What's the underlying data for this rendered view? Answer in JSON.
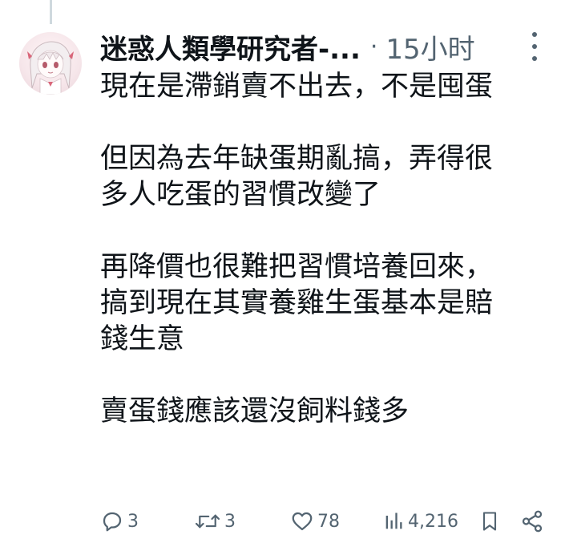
{
  "post": {
    "author": {
      "display_name": "迷惑人類學研究者-...",
      "avatar": "anime-girl-avatar"
    },
    "separator": "·",
    "timestamp": "15小时",
    "more_icon": "more-dots-icon",
    "paragraphs": [
      [
        "現在是滯銷賣不出去，不是囤蛋"
      ],
      [
        "但因為去年缺蛋期亂搞，弄得很",
        "多人吃蛋的習慣改變了"
      ],
      [
        "再降價也很難把習慣培養回來，",
        "搞到現在其實養雞生蛋基本是賠",
        "錢生意"
      ],
      [
        "賣蛋錢應該還沒飼料錢多"
      ]
    ],
    "actions": {
      "reply": {
        "icon": "reply-icon",
        "count": "3"
      },
      "retweet": {
        "icon": "retweet-icon",
        "count": "3"
      },
      "like": {
        "icon": "heart-icon",
        "count": "78"
      },
      "views": {
        "icon": "views-chart-icon",
        "count": "4,216"
      },
      "bookmark": {
        "icon": "bookmark-icon"
      },
      "share": {
        "icon": "share-icon"
      }
    }
  },
  "colors": {
    "text": "#0f1419",
    "secondary": "#536471",
    "thread_line": "#cfd9de",
    "background": "#ffffff"
  }
}
